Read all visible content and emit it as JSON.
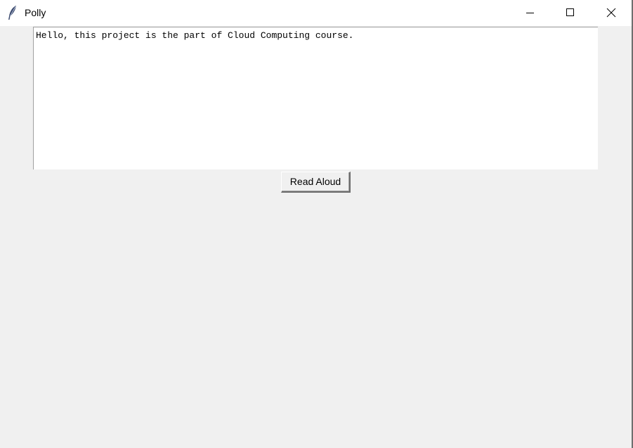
{
  "window": {
    "title": "Polly",
    "icon": "feather-icon",
    "controls": {
      "minimize_icon": "minimize-icon",
      "maximize_icon": "maximize-icon",
      "close_icon": "close-icon"
    }
  },
  "main": {
    "text_area_value": "Hello, this project is the part of Cloud Computing course.",
    "read_button_label": "Read Aloud"
  },
  "colors": {
    "background": "#f0f0f0",
    "titlebar": "#ffffff",
    "textbox": "#ffffff"
  }
}
